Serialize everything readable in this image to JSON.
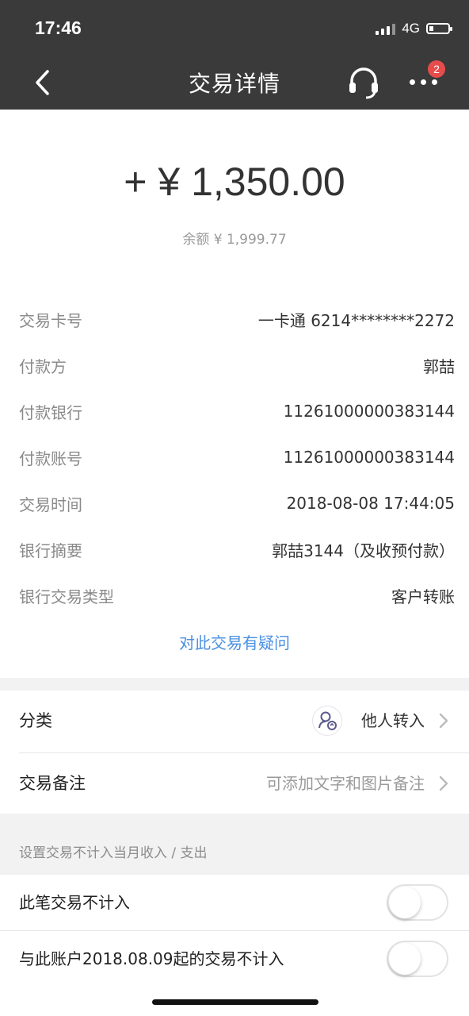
{
  "status_bar": {
    "time": "17:46",
    "network": "4G"
  },
  "nav": {
    "title": "交易详情",
    "badge_count": "2",
    "icons": [
      "back-icon",
      "headset-icon",
      "more-icon"
    ]
  },
  "amount": {
    "value": "+ ¥ 1,350.00",
    "balance": "余额 ¥ 1,999.77"
  },
  "details": [
    {
      "label": "交易卡号",
      "value": "一卡通 6214********2272"
    },
    {
      "label": "付款方",
      "value": "郭喆"
    },
    {
      "label": "付款银行",
      "value": "11261000000383144"
    },
    {
      "label": "付款账号",
      "value": "11261000000383144"
    },
    {
      "label": "交易时间",
      "value": "2018-08-08 17:44:05"
    },
    {
      "label": "银行摘要",
      "value": "郭喆3144（及收预付款）"
    },
    {
      "label": "银行交易类型",
      "value": "客户转账"
    }
  ],
  "question_link": "对此交易有疑问",
  "category": {
    "label": "分类",
    "value": "他人转入",
    "icon": "person-transfer-icon"
  },
  "remark": {
    "label": "交易备注",
    "placeholder": "可添加文字和图片备注"
  },
  "exclude_section": {
    "note": "设置交易不计入当月收入 / 支出",
    "toggles": [
      {
        "label": "此笔交易不计入",
        "on": false
      },
      {
        "label": "与此账户2018.08.09起的交易不计入",
        "on": false
      }
    ]
  },
  "colors": {
    "header_bg": "#3a3a3a",
    "link": "#4a90e2",
    "badge": "#e64c4c",
    "band": "#f2f2f2"
  }
}
